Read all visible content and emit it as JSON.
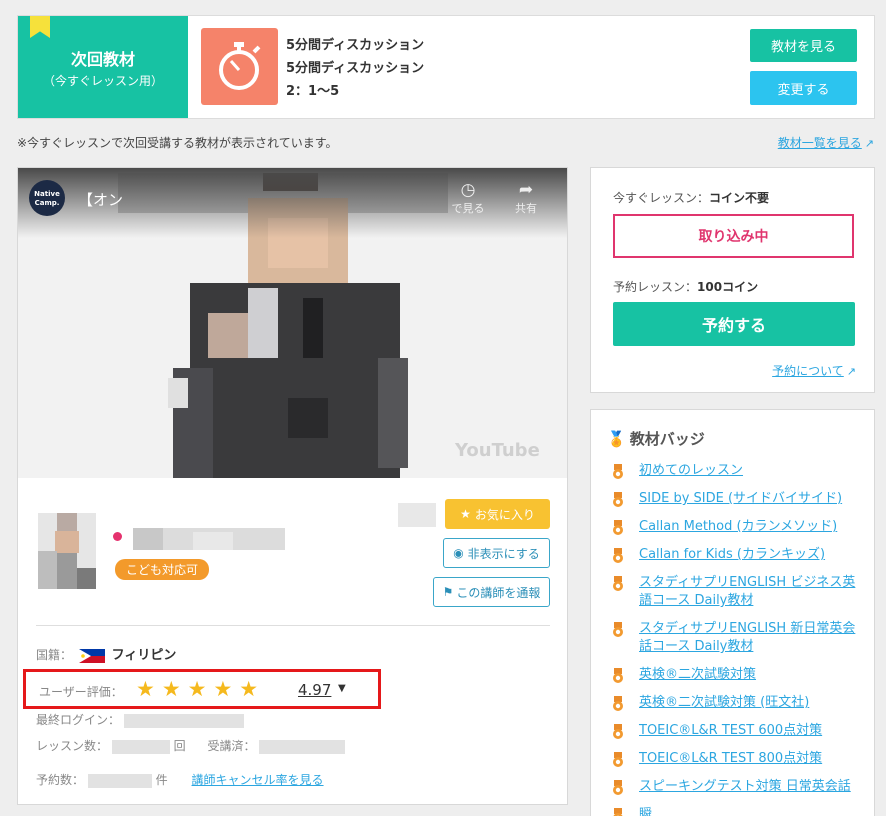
{
  "banner": {
    "title": "次回教材",
    "subtitle": "（今すぐレッスン用）",
    "line1": "5分間ディスカッション",
    "line2": "5分間ディスカッション",
    "line3": "2：1〜5",
    "view_button": "教材を見る",
    "change_button": "変更する"
  },
  "note": "※今すぐレッスンで次回受講する教材が表示されています。",
  "materials_link": "教材一覧を見る",
  "video": {
    "title_prefix": "【オン",
    "logo_line1": "Native",
    "logo_line2": "Camp.",
    "watch_later": "で見る",
    "share": "共有",
    "youtube": "YouTube"
  },
  "teacher": {
    "kids_badge": "こども対応可",
    "favorite_button": "お気に入り",
    "hide_button": "非表示にする",
    "report_button": "この講師を通報",
    "nationality_label": "国籍：",
    "nationality": "フィリピン",
    "rating_label": "ユーザー評価：",
    "stars": "★★★★★",
    "rating": "4.97",
    "last_login_label": "最終ログイン：",
    "lessons_label": "レッスン数：",
    "lessons_unit": "回",
    "attended_label": "受講済：",
    "reservations_label": "予約数：",
    "reservations_unit": "件",
    "cancel_rate_link": "講師キャンセル率を見る"
  },
  "reservation": {
    "now_label": "今すぐレッスン：",
    "now_value": "コイン不要",
    "status": "取り込み中",
    "reserve_label": "予約レッスン：",
    "reserve_value": "100コイン",
    "reserve_button": "予約する",
    "about_link": "予約について"
  },
  "badges": {
    "heading": "教材バッジ",
    "items": [
      "初めてのレッスン",
      "SIDE by SIDE (サイドバイサイド)",
      "Callan Method (カランメソッド)",
      "Callan for Kids (カランキッズ)",
      "スタディサプリENGLISH ビジネス英語コース Daily教材",
      "スタディサプリENGLISH 新日常英会話コース Daily教材",
      "英検®二次試験対策",
      "英検®二次試験対策 (旺文社)",
      "TOEIC®L&R TEST 600点対策",
      "TOEIC®L&R TEST 800点対策",
      "スピーキングテスト対策 日常英会話",
      "瞬"
    ]
  },
  "colors": {
    "teal": "#17c2a3",
    "cyan": "#2cc4ef",
    "status_pink": "#e0356e",
    "highlight_red": "#e5181a",
    "star_gold": "#f5b91e",
    "link_blue": "#2ca6e0"
  }
}
